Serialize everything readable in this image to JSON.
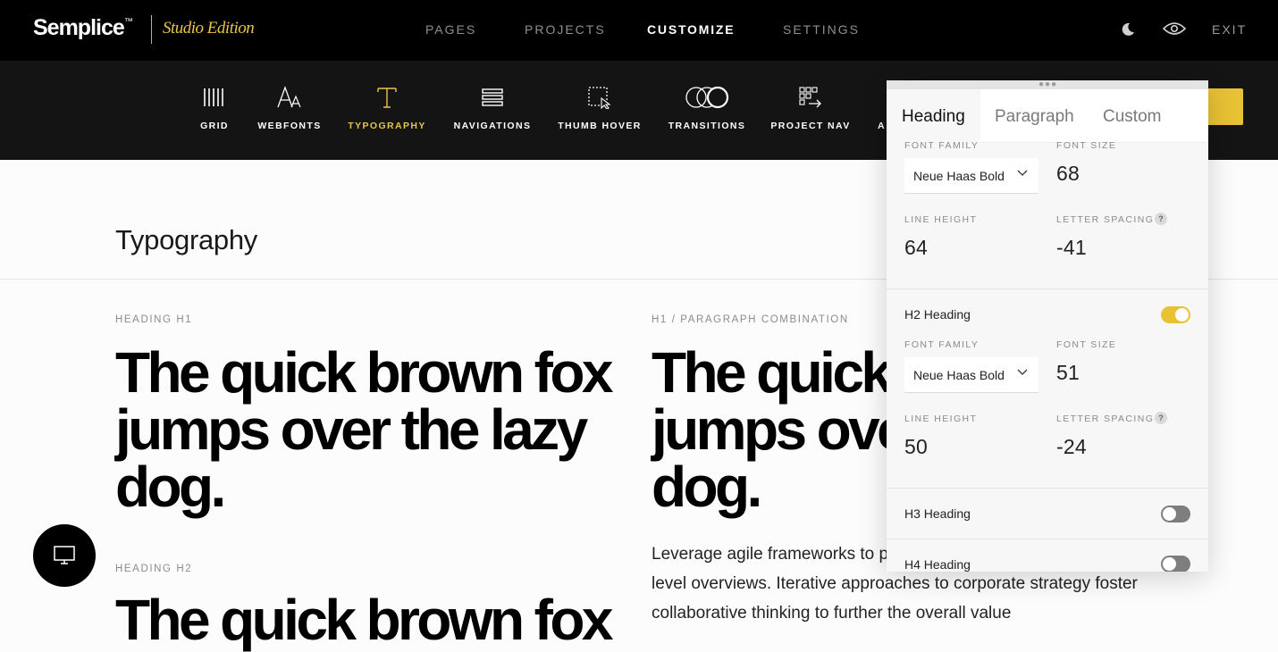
{
  "topbar": {
    "brand": "Semplice",
    "brand_tm": "™",
    "edition": "Studio Edition",
    "nav": [
      "PAGES",
      "PROJECTS",
      "CUSTOMIZE",
      "SETTINGS"
    ],
    "active_nav": "CUSTOMIZE",
    "icons": [
      "moon-icon",
      "eye-icon"
    ],
    "exit_label": "EXIT"
  },
  "subnav": {
    "items": [
      {
        "label": "GRID",
        "icon": "grid-icon"
      },
      {
        "label": "WEBFONTS",
        "icon": "webfonts-icon"
      },
      {
        "label": "TYPOGRAPHY",
        "icon": "typography-icon"
      },
      {
        "label": "NAVIGATIONS",
        "icon": "navigations-icon"
      },
      {
        "label": "THUMB HOVER",
        "icon": "thumb-hover-icon"
      },
      {
        "label": "TRANSITIONS",
        "icon": "transitions-icon"
      },
      {
        "label": "PROJECT NAV",
        "icon": "project-nav-icon"
      },
      {
        "label": "A",
        "icon": ""
      }
    ],
    "active": "TYPOGRAPHY"
  },
  "page": {
    "title": "Typography",
    "h1_label": "HEADING H1",
    "h1_sample": "The quick brown fox jumps over the lazy dog.",
    "combo_label": "H1 / PARAGRAPH COMBINATION",
    "combo_sample": "The quick brown fox jumps over the lazy dog.",
    "paragraph": "Leverage agile frameworks to provide a robust synopsis for high level overviews. Iterative approaches to corporate strategy foster collaborative thinking to further the overall value",
    "h2_label": "HEADING H2",
    "h2_sample": "The quick brown fox"
  },
  "panel": {
    "tabs": [
      "Heading",
      "Paragraph",
      "Custom"
    ],
    "active_tab": "Heading",
    "h1": {
      "font_family_label": "FONT FAMILY",
      "font_family": "Neue Haas Bold",
      "font_size_label": "FONT SIZE",
      "font_size": "68",
      "line_height_label": "LINE HEIGHT",
      "line_height": "64",
      "letter_spacing_label": "LETTER SPACING",
      "letter_spacing": "-41"
    },
    "h2": {
      "title": "H2 Heading",
      "enabled": true,
      "font_family_label": "FONT FAMILY",
      "font_family": "Neue Haas Bold",
      "font_size_label": "FONT SIZE",
      "font_size": "51",
      "line_height_label": "LINE HEIGHT",
      "line_height": "50",
      "letter_spacing_label": "LETTER SPACING",
      "letter_spacing": "-24"
    },
    "h3": {
      "title": "H3 Heading",
      "enabled": false
    },
    "h4": {
      "title": "H4 Heading",
      "enabled": false
    },
    "help_glyph": "?"
  },
  "colors": {
    "accent": "#e8c234",
    "topbar_bg": "#000000",
    "subbar_bg": "#141414"
  }
}
